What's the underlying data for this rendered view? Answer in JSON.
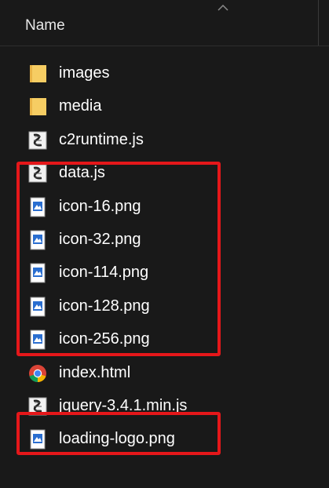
{
  "header": {
    "column_name": "Name"
  },
  "files": [
    {
      "name": "images",
      "icon": "folder-icon"
    },
    {
      "name": "media",
      "icon": "folder-icon"
    },
    {
      "name": "c2runtime.js",
      "icon": "script-file-icon"
    },
    {
      "name": "data.js",
      "icon": "script-file-icon"
    },
    {
      "name": "icon-16.png",
      "icon": "image-file-icon"
    },
    {
      "name": "icon-32.png",
      "icon": "image-file-icon"
    },
    {
      "name": "icon-114.png",
      "icon": "image-file-icon"
    },
    {
      "name": "icon-128.png",
      "icon": "image-file-icon"
    },
    {
      "name": "icon-256.png",
      "icon": "image-file-icon"
    },
    {
      "name": "index.html",
      "icon": "chrome-html-icon"
    },
    {
      "name": "jquery-3.4.1.min.js",
      "icon": "script-file-icon"
    },
    {
      "name": "loading-logo.png",
      "icon": "image-file-icon"
    }
  ],
  "colors": {
    "background": "#191919",
    "highlight": "#e5171a",
    "folder": "#f3c75a"
  }
}
